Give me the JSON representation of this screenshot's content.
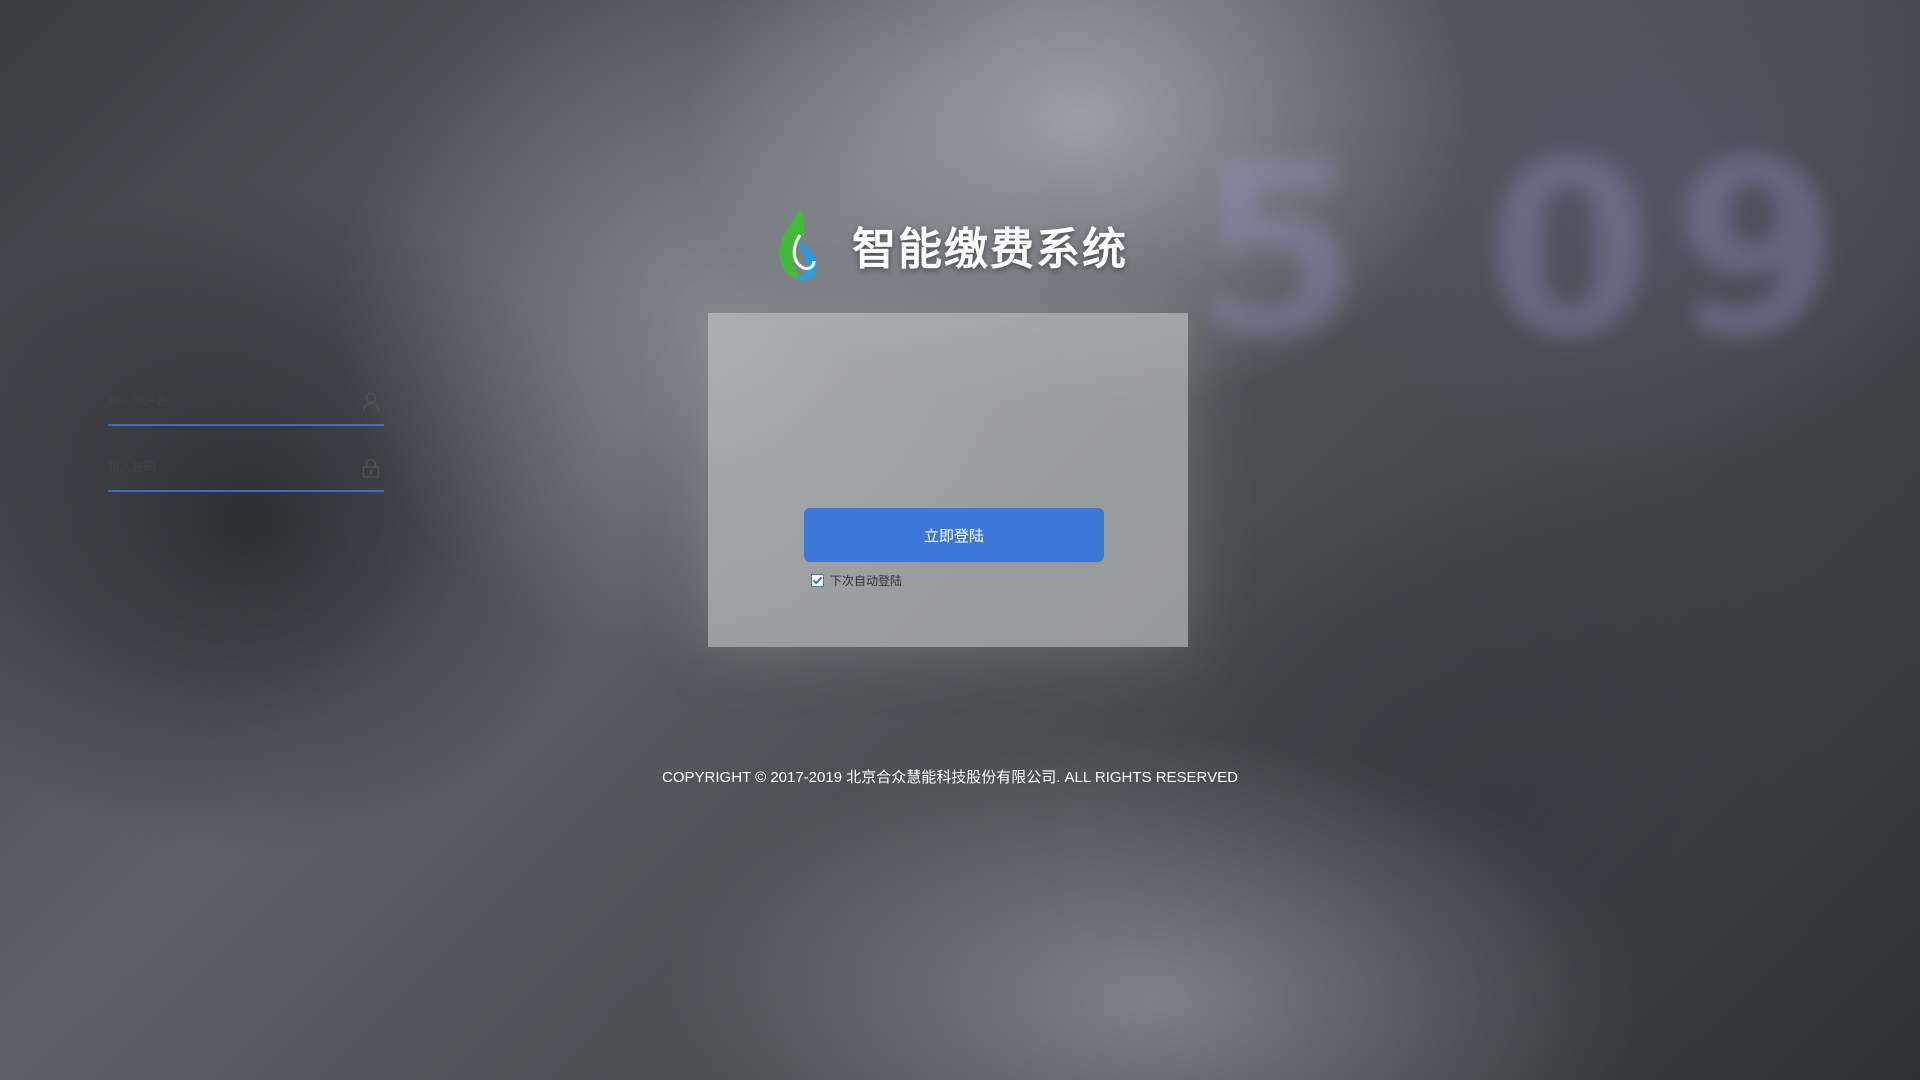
{
  "app": {
    "title": "智能缴费系统"
  },
  "login": {
    "username_placeholder": "输入用户名",
    "username_value": "",
    "password_placeholder": "输入密码",
    "password_value": "",
    "submit_label": "立即登陆",
    "remember_label": "下次自动登陆",
    "remember_checked": true
  },
  "footer": {
    "copyright": "COPYRIGHT © 2017-2019 北京合众慧能科技股份有限公司. ALL RIGHTS RESERVED"
  },
  "theme": {
    "accent": "#3c78d8",
    "card_bg": "rgba(200,200,200,0.62)",
    "text": "#ffffff"
  },
  "icons": {
    "logo": "leaf-drop-logo-icon",
    "user": "user-icon",
    "lock": "lock-icon",
    "check": "checkbox-icon"
  }
}
